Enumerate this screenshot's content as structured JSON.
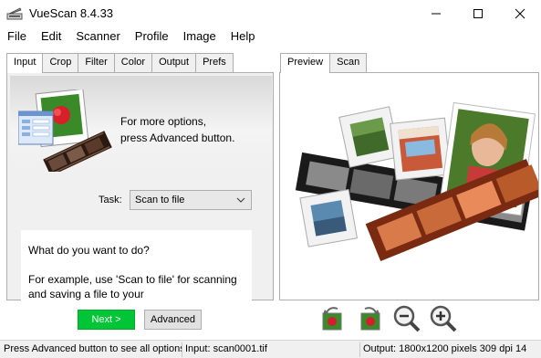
{
  "window": {
    "title": "VueScan 8.4.33"
  },
  "menu": [
    "File",
    "Edit",
    "Scanner",
    "Profile",
    "Image",
    "Help"
  ],
  "left_tabs": [
    "Input",
    "Crop",
    "Filter",
    "Color",
    "Output",
    "Prefs"
  ],
  "left_active_tab": "Input",
  "info": {
    "line1": "For more options,",
    "line2": "press Advanced button."
  },
  "task": {
    "label": "Task:",
    "value": "Scan to file"
  },
  "help": {
    "question": "What do you want to do?",
    "example": "For example, use 'Scan to file' for scanning and saving a file to your"
  },
  "buttons": {
    "next": "Next >",
    "advanced": "Advanced"
  },
  "right_tabs": [
    "Preview",
    "Scan"
  ],
  "right_active_tab": "Preview",
  "toolbar_icons": [
    "rotate-left-icon",
    "rotate-right-icon",
    "zoom-out-icon",
    "zoom-in-icon"
  ],
  "status": {
    "left": "Press Advanced button to see all options",
    "mid": "Input: scan0001.tif",
    "right": "Output: 1800x1200 pixels 309 dpi 14"
  },
  "colors": {
    "next_button": "#00c637",
    "panel_bg": "#f0f0f0",
    "border": "#adadad"
  }
}
